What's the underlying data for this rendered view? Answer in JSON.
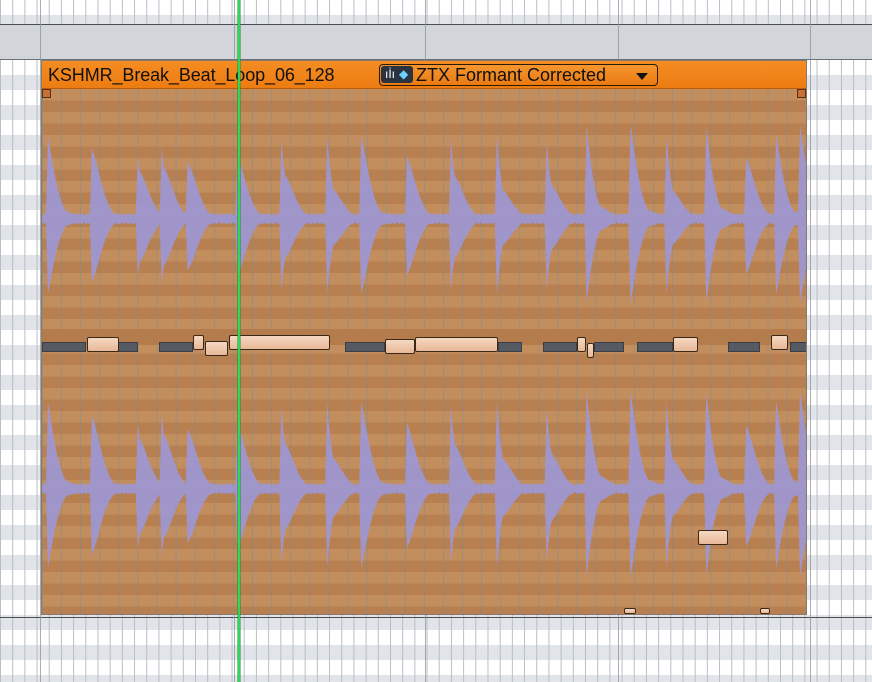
{
  "clip": {
    "name": "KSHMR_Break_Beat_Loop_06_128",
    "warp_mode": "ZTX Formant Corrected",
    "warp_icon": "waveform-gem-icon",
    "colors": {
      "header": "#f0831a",
      "body": "#c28d5d",
      "waveform": "#9c97d6",
      "playhead": "#2fd65a"
    }
  },
  "icons": {
    "dropdown": "chevron-down-icon"
  }
}
